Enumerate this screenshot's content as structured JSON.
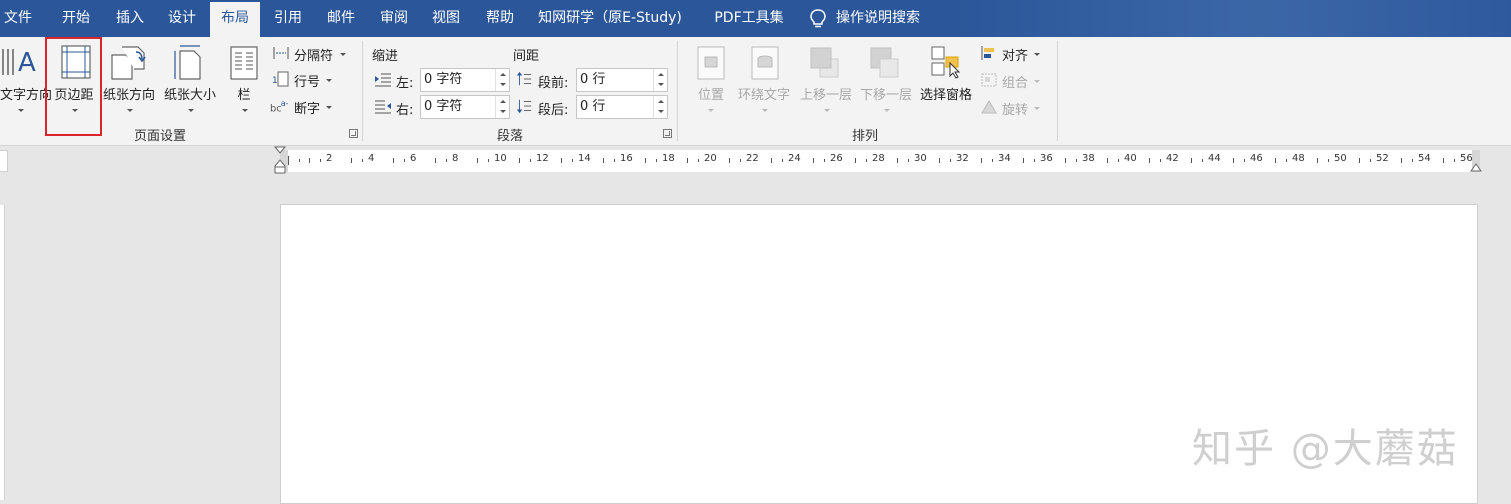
{
  "tabs": [
    {
      "label": "文件"
    },
    {
      "label": "开始"
    },
    {
      "label": "插入"
    },
    {
      "label": "设计"
    },
    {
      "label": "布局"
    },
    {
      "label": "引用"
    },
    {
      "label": "邮件"
    },
    {
      "label": "审阅"
    },
    {
      "label": "视图"
    },
    {
      "label": "帮助"
    },
    {
      "label": "知网研学（原E-Study)"
    },
    {
      "label": "PDF工具集"
    },
    {
      "label": "操作说明搜索"
    }
  ],
  "active_tab": "布局",
  "page_setup": {
    "text_direction": "文字方向",
    "margins": "页边距",
    "orientation": "纸张方向",
    "size": "纸张大小",
    "columns": "栏",
    "breaks": "分隔符",
    "line_numbers": "行号",
    "hyphenation": "断字",
    "group_label": "页面设置"
  },
  "paragraph": {
    "indent_header": "缩进",
    "spacing_header": "间距",
    "left_label": "左:",
    "right_label": "右:",
    "before_label": "段前:",
    "after_label": "段后:",
    "left_value": "0 字符",
    "right_value": "0 字符",
    "before_value": "0 行",
    "after_value": "0 行",
    "group_label": "段落"
  },
  "arrange": {
    "position": "位置",
    "wrap_text": "环绕文字",
    "bring_forward": "上移一层",
    "send_backward": "下移一层",
    "selection_pane": "选择窗格",
    "align": "对齐",
    "group": "组合",
    "rotate": "旋转",
    "group_label": "排列"
  },
  "ruler_numbers": [
    "2",
    "4",
    "6",
    "8",
    "10",
    "12",
    "14",
    "16",
    "18",
    "20",
    "22",
    "24",
    "26",
    "28",
    "30",
    "32",
    "34",
    "36",
    "38",
    "40",
    "42",
    "44",
    "46",
    "48",
    "50",
    "52",
    "54",
    "56"
  ],
  "watermark": "知乎 @大蘑菇",
  "colors": {
    "accent": "#2b579a",
    "highlight": "#d9262d",
    "ribbon_bg": "#f3f3f3"
  }
}
